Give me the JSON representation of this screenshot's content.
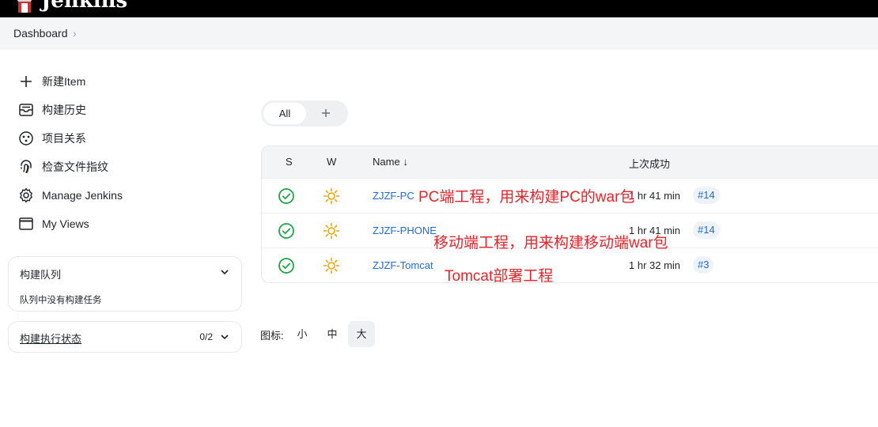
{
  "header": {
    "brand": "Jenkins"
  },
  "breadcrumb": {
    "item": "Dashboard",
    "separator": "›"
  },
  "sidebar": {
    "tasks": [
      {
        "label": "新建Item",
        "icon": "plus-icon"
      },
      {
        "label": "构建历史",
        "icon": "inbox-history-icon"
      },
      {
        "label": "项目关系",
        "icon": "relationship-icon"
      },
      {
        "label": "检查文件指纹",
        "icon": "fingerprint-icon"
      },
      {
        "label": "Manage Jenkins",
        "icon": "gear-icon"
      },
      {
        "label": "My Views",
        "icon": "window-icon"
      }
    ],
    "build_queue": {
      "title": "构建队列",
      "empty_text": "队列中没有构建任务"
    },
    "executor_status": {
      "title": "构建执行状态",
      "count": "0/2"
    }
  },
  "view_tabs": {
    "all_label": "All"
  },
  "table": {
    "headers": {
      "s": "S",
      "w": "W",
      "name": "Name",
      "sort_indicator": "↓",
      "last_success": "上次成功"
    },
    "rows": [
      {
        "name": "ZJZF-PC",
        "last_success": "1 hr 41 min",
        "build": "#14",
        "status_icon": "success-check-icon",
        "weather_icon": "sunny-icon"
      },
      {
        "name": "ZJZF-PHONE",
        "last_success": "1 hr 41 min",
        "build": "#14",
        "status_icon": "success-check-icon",
        "weather_icon": "sunny-icon"
      },
      {
        "name": "ZJZF-Tomcat",
        "last_success": "1 hr 32 min",
        "build": "#3",
        "status_icon": "success-check-icon",
        "weather_icon": "sunny-icon"
      }
    ]
  },
  "annotations": [
    "PC端工程，用来构建PC的war包",
    "移动端工程，用来构建移动端war包",
    "Tomcat部署工程"
  ],
  "icon_size": {
    "label": "图标:",
    "options": [
      "小",
      "中",
      "大"
    ],
    "selected": "大"
  },
  "colors": {
    "link": "#1e6bd6",
    "success": "#1ea446",
    "weather": "#f0a500",
    "annotation": "#e8232a",
    "topbar": "#000000"
  }
}
